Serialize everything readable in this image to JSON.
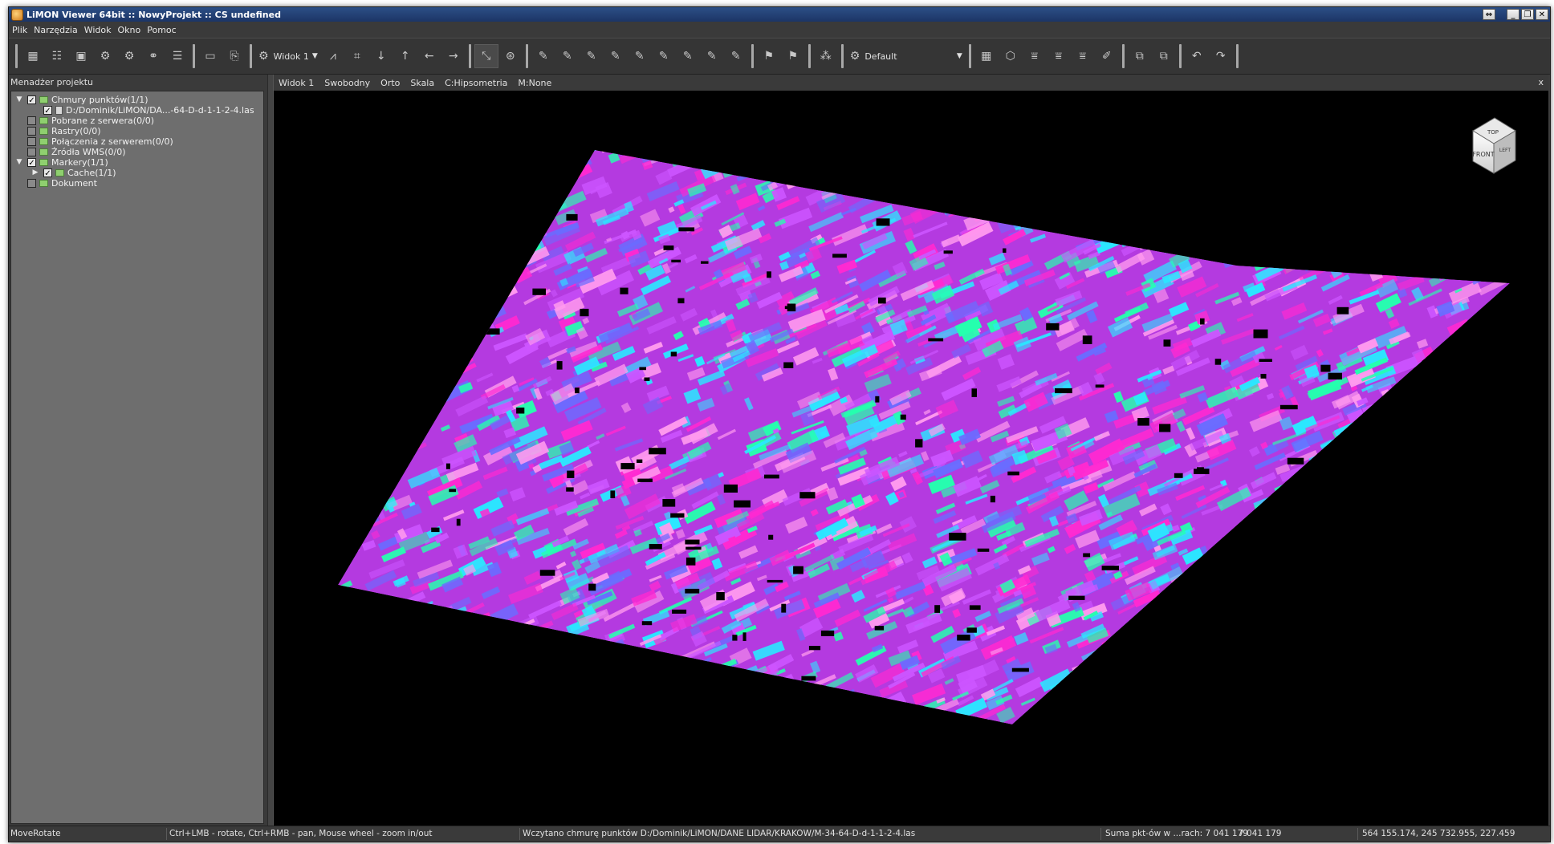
{
  "window": {
    "title": "LiMON Viewer 64bit :: NowyProjekt :: CS undefined"
  },
  "menu": [
    "Plik",
    "Narzędzia",
    "Widok",
    "Okno",
    "Pomoc"
  ],
  "toolbar": {
    "view_combo": "Widok 1",
    "style_combo": "Default"
  },
  "project_panel": {
    "title": "Menadżer projektu",
    "items": [
      {
        "label": "Chmury punktów(1/1)",
        "checked": true,
        "expanded": true
      },
      {
        "label": "D:/Dominik/LiMON/DA...-64-D-d-1-1-2-4.las",
        "checked": true
      },
      {
        "label": "Pobrane z serwera(0/0)",
        "checked": false
      },
      {
        "label": "Rastry(0/0)",
        "checked": false
      },
      {
        "label": "Połączenia z serwerem(0/0)",
        "checked": false
      },
      {
        "label": "Źródła WMS(0/0)",
        "checked": false
      },
      {
        "label": "Markery(1/1)",
        "checked": true,
        "expanded": true
      },
      {
        "label": "Cache(1/1)",
        "checked": true
      },
      {
        "label": "Dokument",
        "checked": false
      }
    ]
  },
  "view": {
    "tabs": [
      "Widok 1",
      "Swobodny",
      "Orto",
      "Skala",
      "C:Hipsometria",
      "M:None"
    ],
    "close": "x",
    "cube_top": "TOP",
    "cube_front": "FRONT",
    "cube_side": "LEFT"
  },
  "status": {
    "mode": "MoveRotate",
    "hint": "Ctrl+LMB - rotate, Ctrl+RMB - pan, Mouse wheel - zoom in/out",
    "message": "Wczytano chmurę punktów D:/Dominik/LiMON/DANE LIDAR/KRAKOW/M-34-64-D-d-1-1-2-4.las",
    "points_label": "Suma pkt-ów w ...rach: 7 041 179",
    "points_value": "7 041 179",
    "coords": "564 155.174, 245 732.955, 227.459"
  },
  "colors": {
    "title_bar": "#2c4f86",
    "panel_bg": "#3a3a3a",
    "tree_bg": "#6e6e6e",
    "cloud_palette": [
      "#ff29d1",
      "#cc55ff",
      "#6a6cff",
      "#2be7ff",
      "#25ffae",
      "#ff9aee"
    ]
  }
}
